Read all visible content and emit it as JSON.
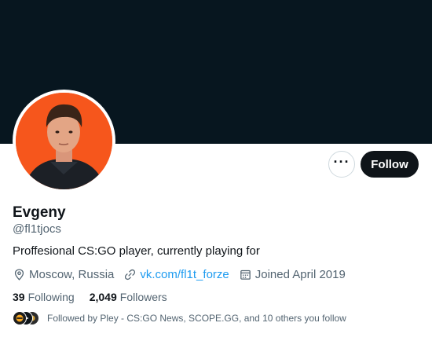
{
  "profile": {
    "display_name": "Evgeny",
    "handle": "@fl1tjocs",
    "bio": "Proffesional CS:GO player, currently playing for",
    "location": "Moscow, Russia",
    "website": "vk.com/fl1t_forze",
    "joined": "Joined April 2019"
  },
  "actions": {
    "more_icon": "more-horizontal-icon",
    "follow_label": "Follow"
  },
  "stats": {
    "following_count": "39",
    "following_label": "Following",
    "followers_count": "2,049",
    "followers_label": "Followers"
  },
  "followed_by": {
    "text": "Followed by Pley - CS:GO News, SCOPE.GG, and 10 others you follow"
  },
  "icons": {
    "location": "location-pin-icon",
    "link": "link-icon",
    "calendar": "calendar-icon"
  },
  "colors": {
    "banner": "#07161f",
    "avatar_background": "#f6561c",
    "link": "#1d9bf0",
    "secondary_text": "#536471",
    "follow_button": "#0f1419"
  }
}
